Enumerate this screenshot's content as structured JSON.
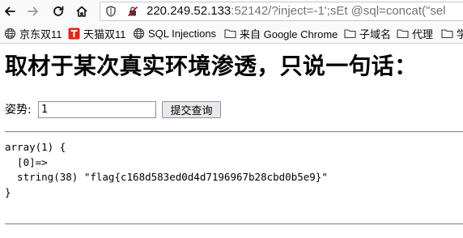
{
  "browser": {
    "url_host": "220.249.52.133",
    "url_rest": ":52142/?inject=-1';sEt @sql=concat(\"sel",
    "bookmarks": [
      {
        "label": "京东双11",
        "icon": "globe-icon"
      },
      {
        "label": "天猫双11",
        "icon": "tmall-icon"
      },
      {
        "label": "SQL Injections",
        "icon": "globe-icon"
      },
      {
        "label": "来自 Google Chrome",
        "icon": "folder-icon"
      },
      {
        "label": "子域名",
        "icon": "folder-icon"
      },
      {
        "label": "代理",
        "icon": "folder-icon"
      },
      {
        "label": "学",
        "icon": "folder-icon"
      }
    ]
  },
  "page": {
    "heading": "取材于某次真实环境渗透，只说一句话：",
    "form": {
      "label": "姿势:",
      "input_value": "1",
      "submit_label": "提交查询"
    },
    "dump": {
      "line1": "array(1) {",
      "line2": "  [0]=>",
      "line3": "  string(38) \"flag{c168d583ed0d4d7196967b28cbd0b5e9}\"",
      "line4": "}"
    }
  }
}
